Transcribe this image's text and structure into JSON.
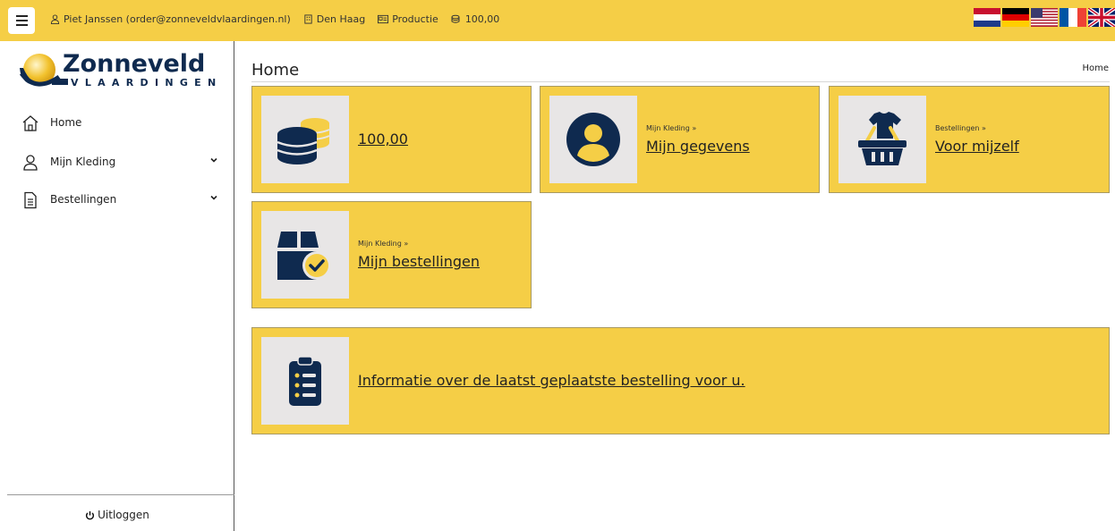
{
  "topbar": {
    "user": "Piet Janssen (order@zonneveldvlaardingen.nl)",
    "location": "Den Haag",
    "environment": "Productie",
    "balance": "100,00",
    "flags": [
      "dutch-flag",
      "german-flag",
      "us-flag",
      "french-flag",
      "uk-flag"
    ]
  },
  "logo": {
    "name": "Zonneveld",
    "subtitle": "VLAARDINGEN"
  },
  "sidebar": {
    "items": [
      {
        "label": "Home",
        "icon": "home-icon"
      },
      {
        "label": "Mijn Kleding",
        "icon": "user-icon",
        "expandable": true
      },
      {
        "label": "Bestellingen",
        "icon": "document-icon",
        "expandable": true
      }
    ],
    "logout": "Uitloggen"
  },
  "main": {
    "title": "Home",
    "breadcrumb": "Home"
  },
  "tiles": [
    {
      "sub": "",
      "link": "100,00",
      "icon": "coins-icon"
    },
    {
      "sub": "Mijn Kleding »",
      "link": "Mijn gegevens",
      "icon": "user-circle-icon"
    },
    {
      "sub": "Bestellingen »",
      "link": "Voor mijzelf",
      "icon": "basket-shirt-icon"
    },
    {
      "sub": "Mijn Kleding »",
      "link": "Mijn bestellingen",
      "icon": "box-check-icon"
    },
    {
      "sub": "",
      "link": "Informatie over de laatst geplaatste bestelling voor u.",
      "icon": "clipboard-list-icon"
    }
  ],
  "colors": {
    "accent": "#f5ce46",
    "navy": "#0f2a4f",
    "tile_bg": "#e8e6e6"
  }
}
